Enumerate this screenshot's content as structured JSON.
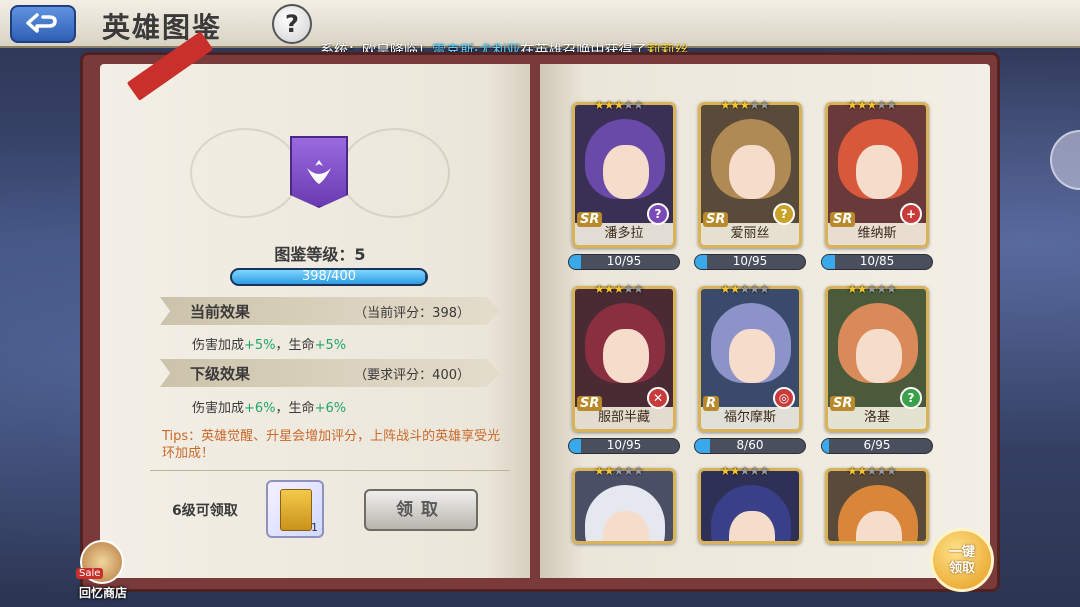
{
  "header": {
    "title": "英雄图鉴",
    "help": "?",
    "ticker": {
      "prefix": "系统：欧皇降临！",
      "hero1": "雷克斯·尤利亚",
      "middle": "在英雄召唤中获得了",
      "hero2": "莉莉丝"
    }
  },
  "codex": {
    "level_label": "图鉴等级：5",
    "progress": {
      "current": 398,
      "max": 400,
      "text": "398/400"
    },
    "current_effect": {
      "title": "当前效果",
      "score": "（当前评分：398）",
      "text_a": "伤害加成",
      "value_a": "+5%",
      "text_b": "，生命",
      "value_b": "+5%"
    },
    "next_effect": {
      "title": "下级效果",
      "score": "（要求评分：400）",
      "text_a": "伤害加成",
      "value_a": "+6%",
      "text_b": "，生命",
      "value_b": "+6%"
    },
    "tips": "Tips：英雄觉醒、升星会增加评分，上阵战斗的英雄享受光环加成！",
    "reward_label": "6级可领取",
    "reward_qty": "1",
    "claim_button": "领取"
  },
  "shop": {
    "sale": "Sale",
    "label": "回忆商店"
  },
  "onekey": {
    "line1": "一键",
    "line2": "领取"
  },
  "heroes": [
    {
      "name": "潘多拉",
      "rarity": "SR",
      "stars": 3,
      "progress": "10/95",
      "fill": 0.105,
      "hair": "#6a4aa8",
      "bg": "#3a2f55",
      "class_color": "#7b4ab8",
      "class_glyph": "?"
    },
    {
      "name": "爱丽丝",
      "rarity": "SR",
      "stars": 3,
      "progress": "10/95",
      "fill": 0.105,
      "hair": "#b08a55",
      "bg": "#5a4a3a",
      "class_color": "#c9a22a",
      "class_glyph": "?"
    },
    {
      "name": "维纳斯",
      "rarity": "SR",
      "stars": 3,
      "progress": "10/85",
      "fill": 0.118,
      "hair": "#d8583c",
      "bg": "#6a3a3a",
      "class_color": "#c93a3a",
      "class_glyph": "+"
    },
    {
      "name": "服部半藏",
      "rarity": "SR",
      "stars": 3,
      "progress": "10/95",
      "fill": 0.105,
      "hair": "#8a2f3f",
      "bg": "#4a2a33",
      "class_color": "#c93a3a",
      "class_glyph": "✕"
    },
    {
      "name": "福尔摩斯",
      "rarity": "R",
      "stars": 2,
      "progress": "8/60",
      "fill": 0.133,
      "hair": "#8c93c9",
      "bg": "#3a4a6a",
      "class_color": "#c93a3a",
      "class_glyph": "◎"
    },
    {
      "name": "洛基",
      "rarity": "SR",
      "stars": 2,
      "progress": "6/95",
      "fill": 0.063,
      "hair": "#d98a58",
      "bg": "#4a5a3a",
      "class_color": "#3aa04a",
      "class_glyph": "?"
    },
    {
      "name": "",
      "rarity": "",
      "stars": 2,
      "progress": "",
      "fill": 0,
      "hair": "#e6e8f0",
      "bg": "#4a4f66",
      "class_color": "#888888",
      "class_glyph": ""
    },
    {
      "name": "",
      "rarity": "",
      "stars": 2,
      "progress": "",
      "fill": 0,
      "hair": "#3a3f8a",
      "bg": "#2f3055",
      "class_color": "#888888",
      "class_glyph": ""
    },
    {
      "name": "",
      "rarity": "",
      "stars": 2,
      "progress": "",
      "fill": 0,
      "hair": "#d9863a",
      "bg": "#5a4a3a",
      "class_color": "#888888",
      "class_glyph": ""
    }
  ]
}
